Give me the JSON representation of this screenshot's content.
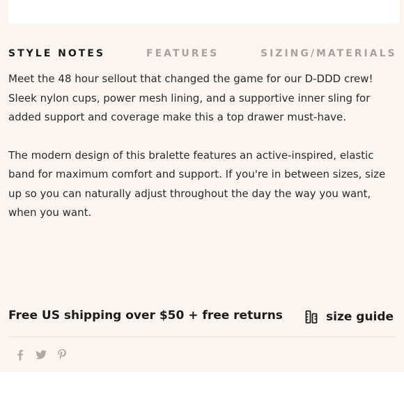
{
  "tabs": [
    {
      "label": "STYLE NOTES",
      "active": true
    },
    {
      "label": "FEATURES",
      "active": false
    },
    {
      "label": "SIZING/MATERIALS",
      "active": false
    }
  ],
  "description": {
    "paragraphs": [
      "Meet the 48 hour sellout that changed the game for our D-DDD crew! Sleek nylon cups, power mesh lining, and a supportive inner sling for added support and coverage make this a top drawer must-have.",
      "The modern design of this bralette features an active-inspired, elastic band for maximum comfort and support. If you're in between sizes, size up so you can naturally adjust throughout the day the way you want, when you want."
    ]
  },
  "shipping": {
    "text": "Free US shipping over $50 + free returns",
    "size_guide_label": "size guide",
    "size_guide_icon": "ruler-icon"
  },
  "social": {
    "icons": [
      "facebook-icon",
      "twitter-icon",
      "pinterest-icon"
    ]
  },
  "colors": {
    "panel_background": "#fbf5f1",
    "active_tab": "#1c1c1c",
    "inactive_tab": "#a8a09a",
    "social_icon": "#b3a8a3"
  }
}
